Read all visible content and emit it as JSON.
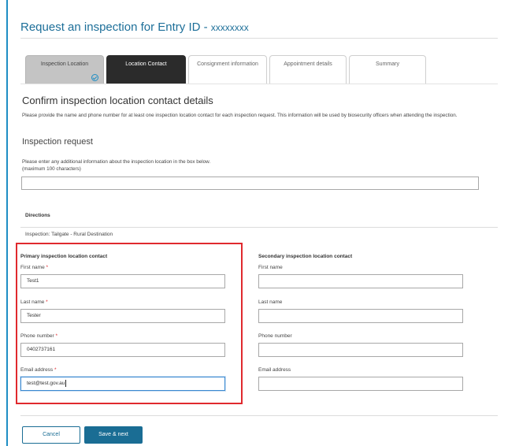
{
  "page": {
    "title_prefix": "Request an inspection for Entry ID - ",
    "entry_id": "xxxxxxxx"
  },
  "tabs": [
    {
      "label": "Inspection Location",
      "state": "done"
    },
    {
      "label": "Location Contact",
      "state": "active"
    },
    {
      "label": "Consignment information",
      "state": "default"
    },
    {
      "label": "Appointment details",
      "state": "default"
    },
    {
      "label": "Summary",
      "state": "default"
    }
  ],
  "section": {
    "heading": "Confirm inspection location contact details",
    "intro": "Please provide the name and phone number for at least one inspection location contact for each inspection request. This information will be used by biosecurity officers when attending the inspection."
  },
  "inspection_request": {
    "heading": "Inspection request",
    "hint_line1": "Please enter any additional information about the inspection location in the box below.",
    "hint_line2": "(maximum 100 characters)",
    "value": ""
  },
  "directions": {
    "label": "Directions",
    "value": "Inspection: Tailgate - Rural Destination"
  },
  "primary": {
    "heading": "Primary inspection location contact",
    "first_name_label": "First name",
    "first_name_value": "Test1",
    "last_name_label": "Last name",
    "last_name_value": "Tester",
    "phone_label": "Phone number",
    "phone_value": "0402737161",
    "email_label": "Email address",
    "email_value": "test@test.gov.au",
    "required_marker": "*"
  },
  "secondary": {
    "heading": "Secondary inspection location contact",
    "first_name_label": "First name",
    "first_name_value": "",
    "last_name_label": "Last name",
    "last_name_value": "",
    "phone_label": "Phone number",
    "phone_value": "",
    "email_label": "Email address",
    "email_value": ""
  },
  "actions": {
    "cancel_label": "Cancel",
    "save_label": "Save & next"
  },
  "colors": {
    "accent": "#1d6f99",
    "primary_button": "#1a6d94",
    "required": "#e0292e",
    "highlight_border": "#e0292e"
  }
}
